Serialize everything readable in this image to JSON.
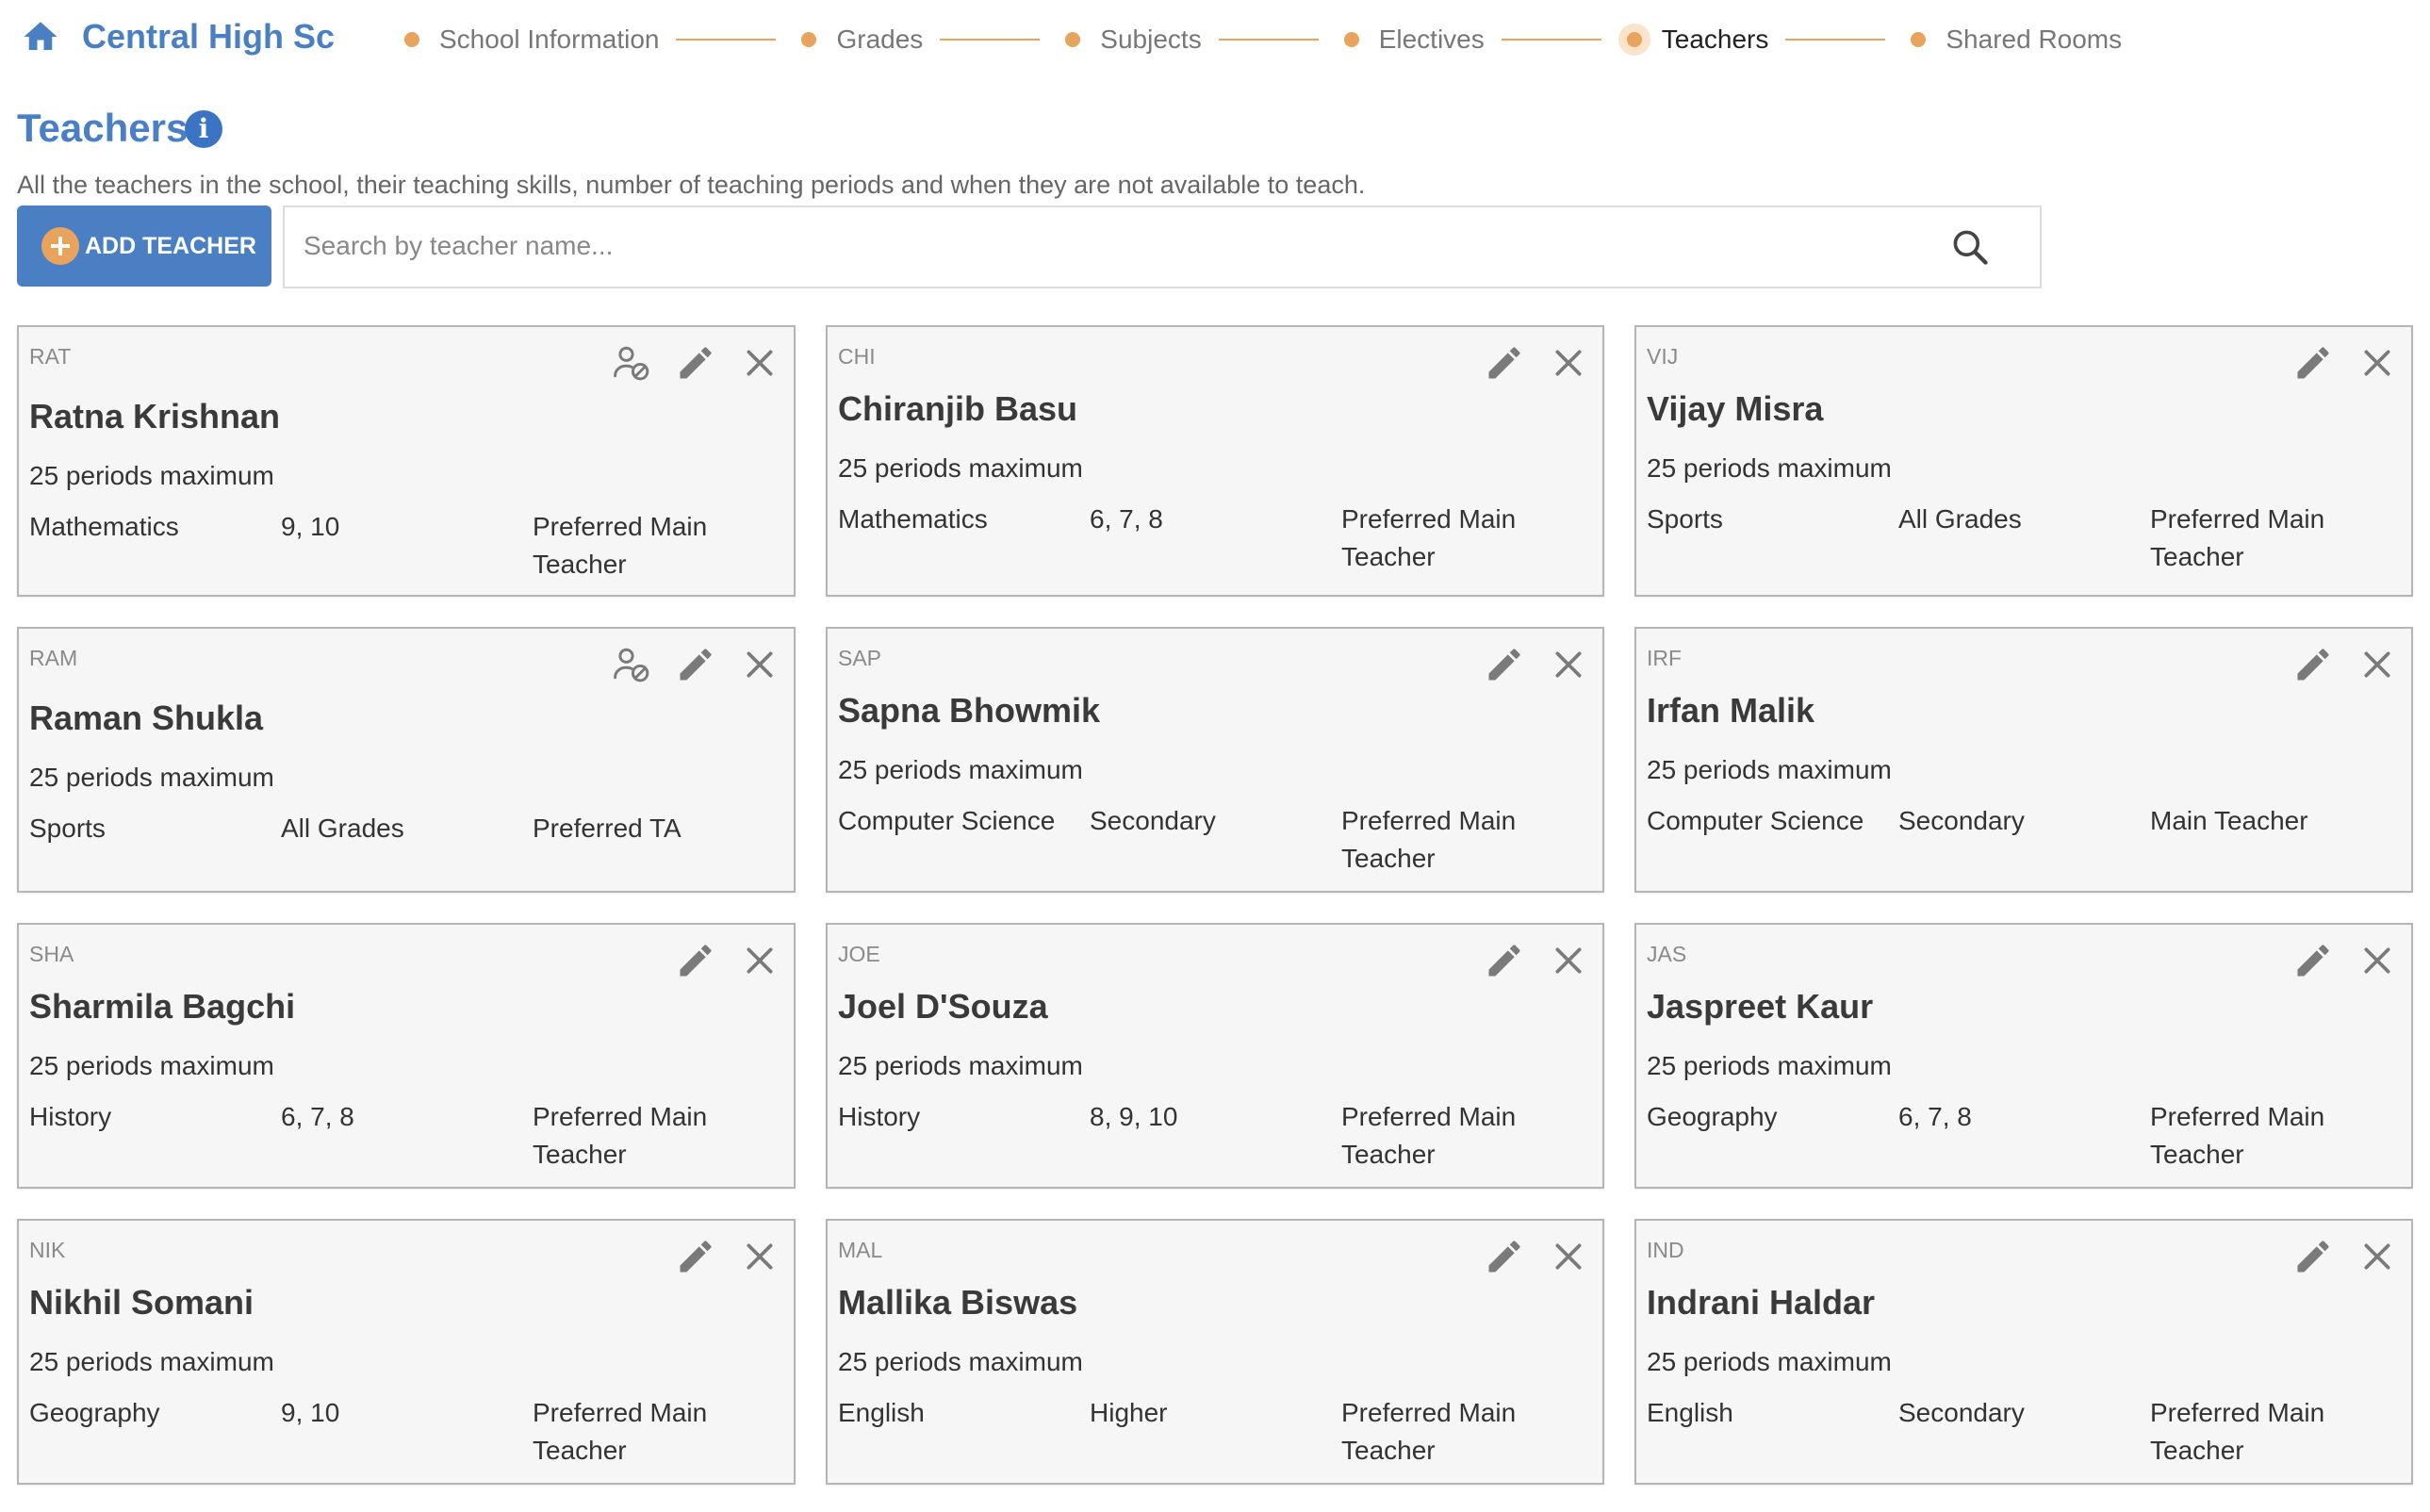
{
  "header": {
    "school_name": "Central High Sc",
    "steps": [
      {
        "label": "School Information",
        "active": false
      },
      {
        "label": "Grades",
        "active": false
      },
      {
        "label": "Subjects",
        "active": false
      },
      {
        "label": "Electives",
        "active": false
      },
      {
        "label": "Teachers",
        "active": true
      },
      {
        "label": "Shared Rooms",
        "active": false
      }
    ]
  },
  "page": {
    "title": "Teachers",
    "info_glyph": "i",
    "description": "All the teachers in the school, their teaching skills, number of teaching periods and when they are not available to teach."
  },
  "toolbar": {
    "add_label": "ADD TEACHER",
    "search_placeholder": "Search by teacher name...",
    "search_value": ""
  },
  "icons": {
    "home": "home-icon",
    "info": "info-icon",
    "add": "plus-circle-icon",
    "search": "search-icon",
    "unavailable": "user-unavailable-icon",
    "edit": "pencil-icon",
    "delete": "close-icon"
  },
  "colors": {
    "brand_blue": "#4a7fc4",
    "accent_orange": "#e8a35d",
    "card_bg": "#f6f6f6",
    "card_border": "#b5b5b5",
    "icon_gray": "#7a7a7a"
  },
  "teachers": [
    {
      "code": "RAT",
      "name": "Ratna Krishnan",
      "periods": "25 periods maximum",
      "subject": "Mathematics",
      "grades": "9, 10",
      "role": "Preferred Main Teacher",
      "has_unavailability": true
    },
    {
      "code": "CHI",
      "name": "Chiranjib Basu",
      "periods": "25 periods maximum",
      "subject": "Mathematics",
      "grades": "6, 7, 8",
      "role": "Preferred Main Teacher",
      "has_unavailability": false
    },
    {
      "code": "VIJ",
      "name": "Vijay Misra",
      "periods": "25 periods maximum",
      "subject": "Sports",
      "grades": "All Grades",
      "role": "Preferred Main Teacher",
      "has_unavailability": false
    },
    {
      "code": "RAM",
      "name": "Raman Shukla",
      "periods": "25 periods maximum",
      "subject": "Sports",
      "grades": "All Grades",
      "role": "Preferred TA",
      "has_unavailability": true
    },
    {
      "code": "SAP",
      "name": "Sapna Bhowmik",
      "periods": "25 periods maximum",
      "subject": "Computer Science",
      "grades": "Secondary",
      "role": "Preferred Main Teacher",
      "has_unavailability": false
    },
    {
      "code": "IRF",
      "name": "Irfan Malik",
      "periods": "25 periods maximum",
      "subject": "Computer Science",
      "grades": "Secondary",
      "role": "Main Teacher",
      "has_unavailability": false
    },
    {
      "code": "SHA",
      "name": "Sharmila Bagchi",
      "periods": "25 periods maximum",
      "subject": "History",
      "grades": "6, 7, 8",
      "role": "Preferred Main Teacher",
      "has_unavailability": false
    },
    {
      "code": "JOE",
      "name": "Joel D'Souza",
      "periods": "25 periods maximum",
      "subject": "History",
      "grades": "8, 9, 10",
      "role": "Preferred Main Teacher",
      "has_unavailability": false
    },
    {
      "code": "JAS",
      "name": "Jaspreet Kaur",
      "periods": "25 periods maximum",
      "subject": "Geography",
      "grades": "6, 7, 8",
      "role": "Preferred Main Teacher",
      "has_unavailability": false
    },
    {
      "code": "NIK",
      "name": "Nikhil Somani",
      "periods": "25 periods maximum",
      "subject": "Geography",
      "grades": "9, 10",
      "role": "Preferred Main Teacher",
      "has_unavailability": false
    },
    {
      "code": "MAL",
      "name": "Mallika Biswas",
      "periods": "25 periods maximum",
      "subject": "English",
      "grades": "Higher",
      "role": "Preferred Main Teacher",
      "has_unavailability": false
    },
    {
      "code": "IND",
      "name": "Indrani Haldar",
      "periods": "25 periods maximum",
      "subject": "English",
      "grades": "Secondary",
      "role": "Preferred Main Teacher",
      "has_unavailability": false
    }
  ]
}
